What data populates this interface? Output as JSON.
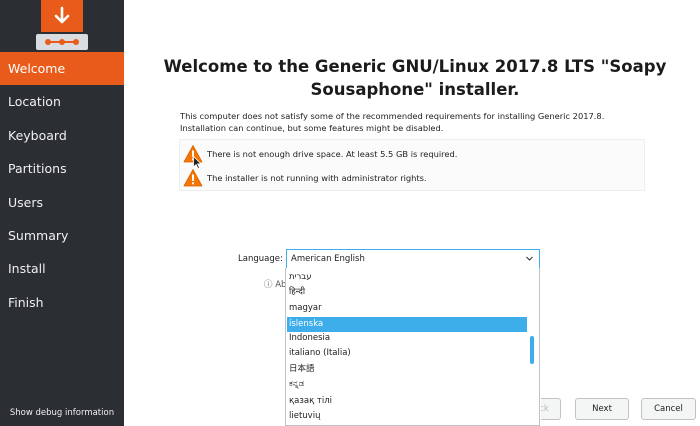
{
  "sidebar": {
    "items": [
      {
        "label": "Welcome",
        "active": true
      },
      {
        "label": "Location"
      },
      {
        "label": "Keyboard"
      },
      {
        "label": "Partitions"
      },
      {
        "label": "Users"
      },
      {
        "label": "Summary"
      },
      {
        "label": "Install"
      },
      {
        "label": "Finish"
      }
    ],
    "debug_label": "Show debug information"
  },
  "main": {
    "title": "Welcome to the Generic GNU/Linux 2017.8 LTS \"Soapy Sousaphone\" installer.",
    "requirements_line1": "This computer does not satisfy some of the recommended requirements for installing Generic 2017.8.",
    "requirements_line2": "Installation can continue, but some features might be disabled.",
    "warnings": [
      "There is not enough drive space. At least 5.5 GB is required.",
      "The installer is not running with administrator rights."
    ],
    "language_label": "Language:",
    "language_selected": "American English",
    "about_partial": "ⓘ Ab",
    "language_options": [
      "עברית",
      "हिन्दी",
      "magyar",
      "íslenska",
      "Indonesia",
      "italiano (Italia)",
      "日本語",
      "ಕನ್ನಡ",
      "қазақ тілі",
      "lietuvių"
    ],
    "selected_option_index": 3
  },
  "buttons": {
    "back": "Back",
    "next": "Next",
    "cancel": "Cancel"
  },
  "colors": {
    "accent": "#e85b1a",
    "sidebar_bg": "#2b2e33",
    "highlight": "#3daee9"
  }
}
